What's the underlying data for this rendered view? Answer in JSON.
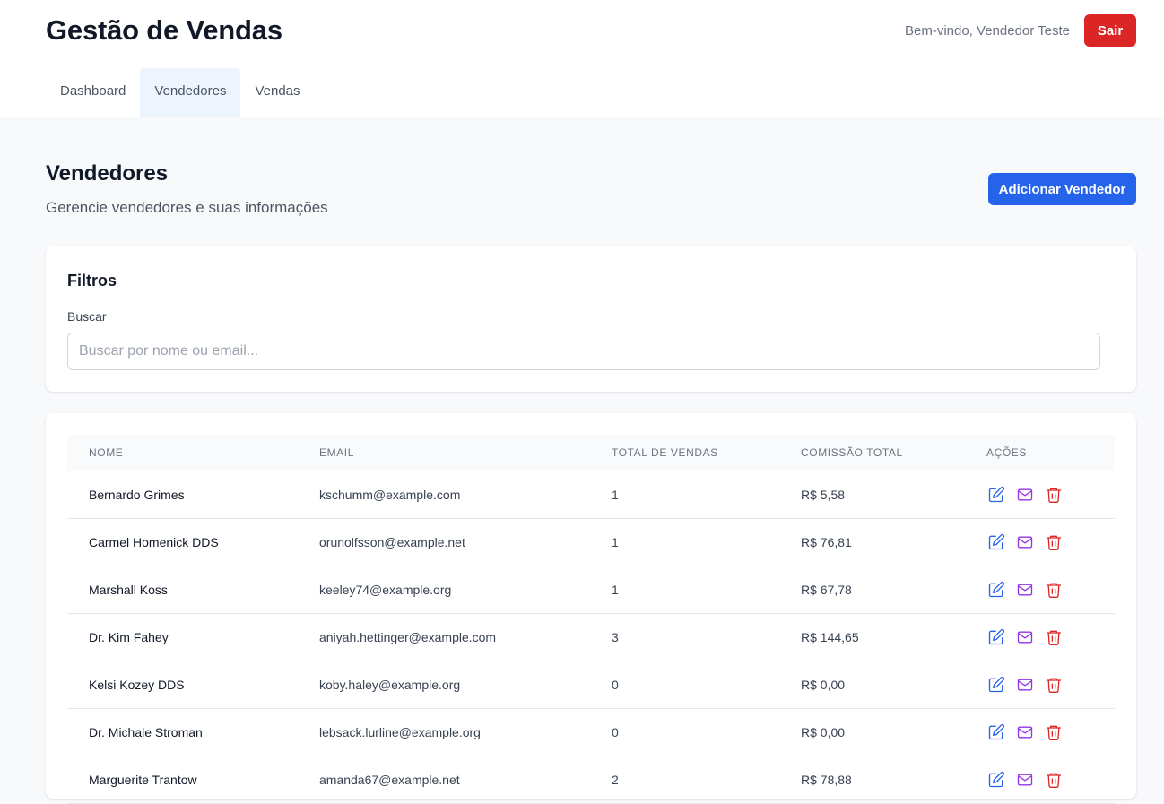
{
  "header": {
    "title": "Gestão de Vendas",
    "welcome": "Bem-vindo, Vendedor Teste",
    "logout_label": "Sair"
  },
  "tabs": [
    {
      "label": "Dashboard",
      "active": false
    },
    {
      "label": "Vendedores",
      "active": true
    },
    {
      "label": "Vendas",
      "active": false
    }
  ],
  "page": {
    "title": "Vendedores",
    "subtitle": "Gerencie vendedores e suas informações",
    "add_button": "Adicionar Vendedor"
  },
  "filters": {
    "title": "Filtros",
    "search_label": "Buscar",
    "search_placeholder": "Buscar por nome ou email...",
    "search_value": ""
  },
  "table": {
    "columns": [
      "NOME",
      "EMAIL",
      "TOTAL DE VENDAS",
      "COMISSÃO TOTAL",
      "AÇÕES"
    ],
    "rows": [
      {
        "nome": "Bernardo Grimes",
        "email": "kschumm@example.com",
        "total": "1",
        "comissao": "R$ 5,58"
      },
      {
        "nome": "Carmel Homenick DDS",
        "email": "orunolfsson@example.net",
        "total": "1",
        "comissao": "R$ 76,81"
      },
      {
        "nome": "Marshall Koss",
        "email": "keeley74@example.org",
        "total": "1",
        "comissao": "R$ 67,78"
      },
      {
        "nome": "Dr. Kim Fahey",
        "email": "aniyah.hettinger@example.com",
        "total": "3",
        "comissao": "R$ 144,65"
      },
      {
        "nome": "Kelsi Kozey DDS",
        "email": "koby.haley@example.org",
        "total": "0",
        "comissao": "R$ 0,00"
      },
      {
        "nome": "Dr. Michale Stroman",
        "email": "lebsack.lurline@example.org",
        "total": "0",
        "comissao": "R$ 0,00"
      },
      {
        "nome": "Marguerite Trantow",
        "email": "amanda67@example.net",
        "total": "2",
        "comissao": "R$ 78,88"
      }
    ]
  },
  "icons": {
    "edit": "edit-icon",
    "email": "mail-icon",
    "delete": "trash-icon"
  },
  "colors": {
    "primary": "#2563eb",
    "danger": "#dc2626",
    "mail": "#9333ea",
    "active_tab_bg": "#eef4fd"
  }
}
